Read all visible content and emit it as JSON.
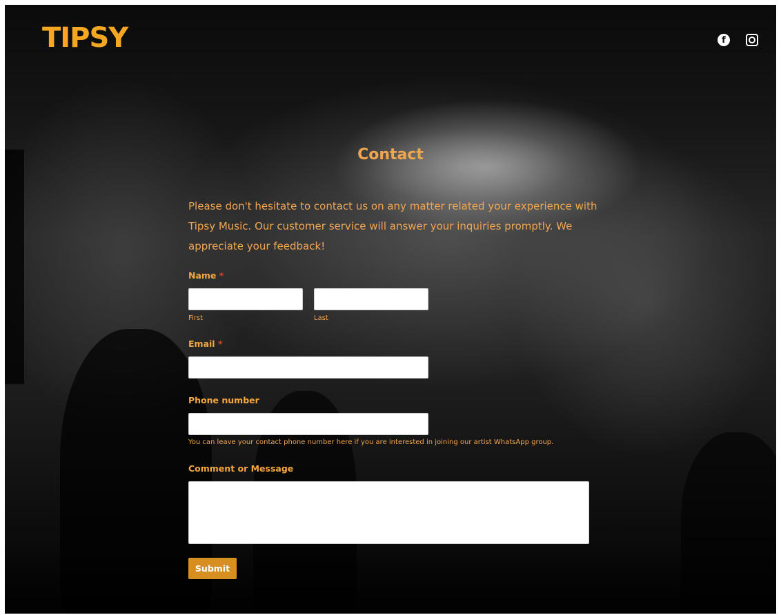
{
  "header": {
    "logo_text": "TIPSY",
    "brand_color": "#f5a623",
    "social_icons": [
      "facebook-icon",
      "instagram-icon"
    ]
  },
  "contact": {
    "title": "Contact",
    "intro": "Please don't hesitate to contact us on any matter related your experience with Tipsy Music. Our customer service will answer your inquiries promptly. We appreciate your feedback!",
    "accent_color": "#f0a64d"
  },
  "form": {
    "name_label": "Name",
    "required_mark": "*",
    "first_sublabel": "First",
    "last_sublabel": "Last",
    "first_value": "",
    "last_value": "",
    "email_label": "Email",
    "email_value": "",
    "phone_label": "Phone number",
    "phone_value": "",
    "phone_hint": "You can leave your contact phone number here if you are interested in joining our artist WhatsApp group.",
    "message_label": "Comment or Message",
    "message_value": "",
    "submit_label": "Submit",
    "submit_color": "#d88f22"
  }
}
